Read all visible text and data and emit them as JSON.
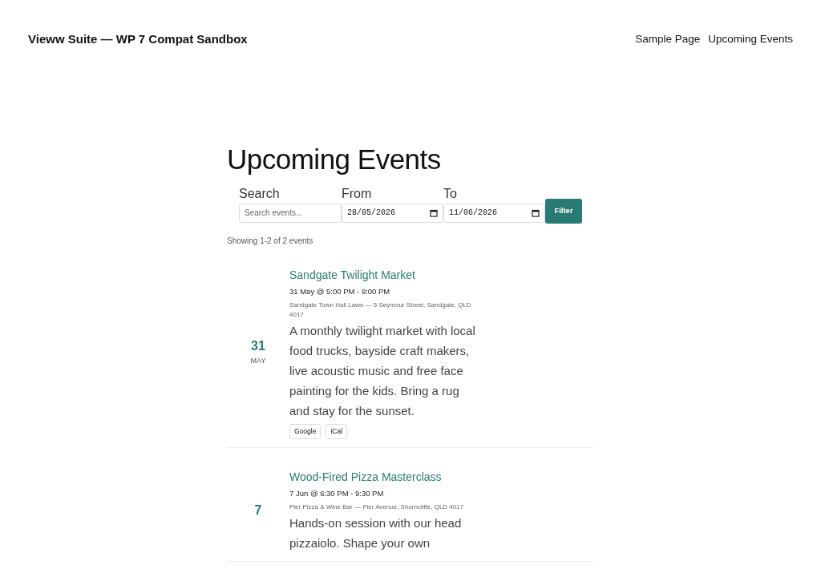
{
  "site_title": "Vieww Suite — WP 7 Compat Sandbox",
  "nav": [
    "Sample Page",
    "Upcoming Events"
  ],
  "heading": "Upcoming Events",
  "filters": {
    "search": {
      "label": "Search",
      "placeholder": "Search events..."
    },
    "from": {
      "label": "From",
      "value": "28/05/2026"
    },
    "to": {
      "label": "To",
      "value": "11/06/2026"
    },
    "button": "Filter"
  },
  "result_count": "Showing 1-2 of 2 events",
  "events": [
    {
      "day": "31",
      "month": "MAY",
      "title": "Sandgate Twilight Market",
      "when": "31 May @ 5:00 PM - 9:00 PM",
      "where": "Sandgate Town Hall Lawn — 5 Seymour Street, Sandgate, QLD 4017",
      "description": "A monthly twilight market with local food trucks, bayside craft makers, live acoustic music and free face painting for the kids. Bring a rug and stay for the sunset.",
      "links": [
        "Google",
        "iCal"
      ]
    },
    {
      "day": "7",
      "title": "Wood-Fired Pizza Masterclass",
      "when": "7 Jun @ 6:30 PM - 9:30 PM",
      "where": "Pier Pizza & Wine Bar — Pier Avenue, Shorncliffe, QLD 4017",
      "description": "Hands-on session with our head pizzaiolo. Shape your own"
    }
  ]
}
